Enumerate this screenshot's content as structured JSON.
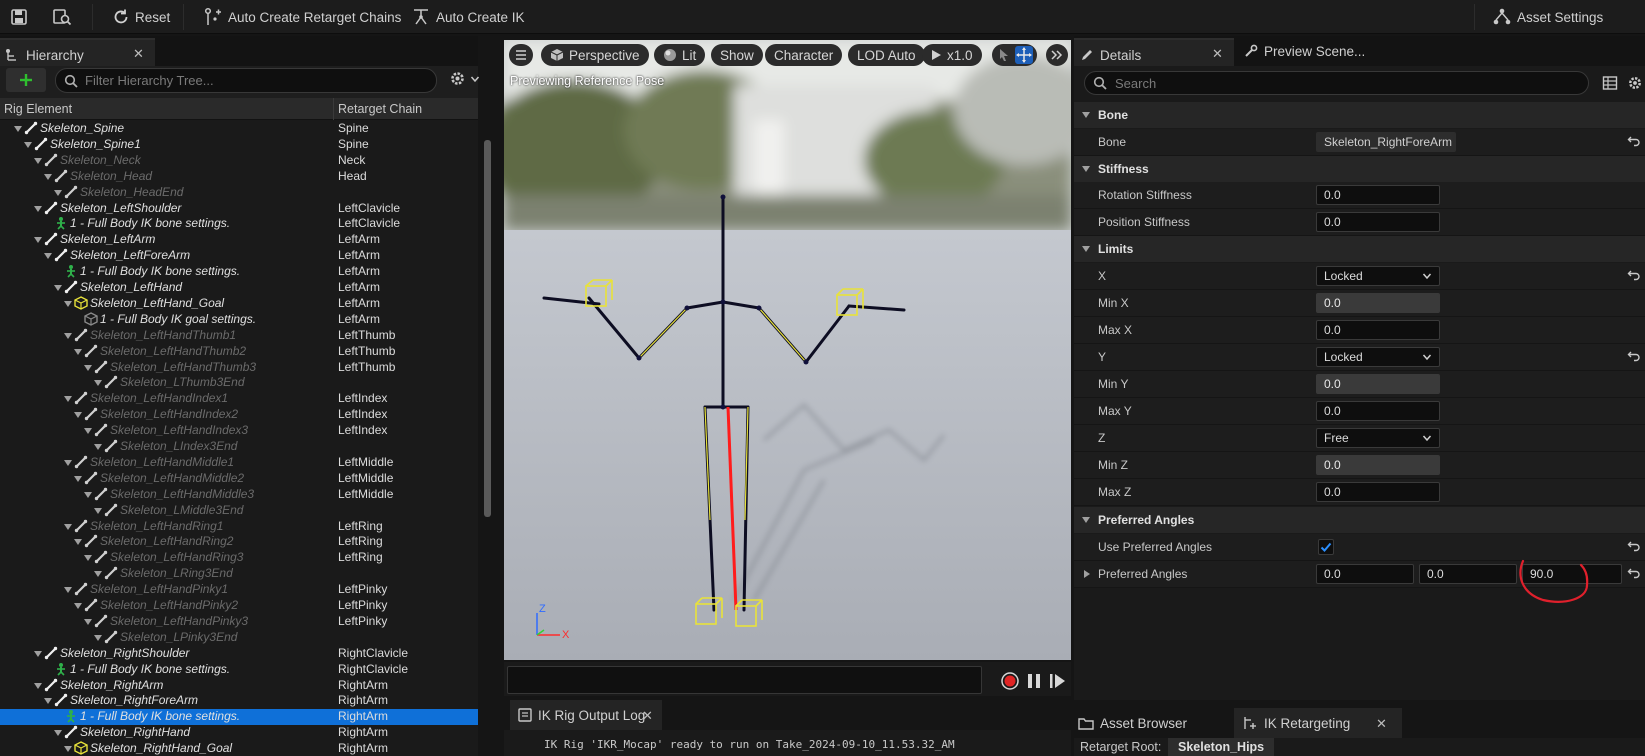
{
  "toolbar": {
    "reset_label": "Reset",
    "auto_chains_label": "Auto Create Retarget Chains",
    "auto_ik_label": "Auto Create IK",
    "asset_settings_label": "Asset Settings"
  },
  "hierarchy": {
    "tab_label": "Hierarchy",
    "filter_placeholder": "Filter Hierarchy Tree...",
    "col_element": "Rig Element",
    "col_chain": "Retarget Chain",
    "rows": [
      {
        "name": "Skeleton_Spine",
        "chain": "Spine"
      },
      {
        "name": "Skeleton_Spine1",
        "chain": "Spine"
      },
      {
        "name": "Skeleton_Neck",
        "chain": "Neck"
      },
      {
        "name": "Skeleton_Head",
        "chain": "Head"
      },
      {
        "name": "Skeleton_HeadEnd",
        "chain": ""
      },
      {
        "name": "Skeleton_LeftShoulder",
        "chain": "LeftClavicle"
      },
      {
        "name": "1 - Full Body IK bone settings.",
        "chain": "LeftClavicle"
      },
      {
        "name": "Skeleton_LeftArm",
        "chain": "LeftArm"
      },
      {
        "name": "Skeleton_LeftForeArm",
        "chain": "LeftArm"
      },
      {
        "name": "1 - Full Body IK bone settings.",
        "chain": "LeftArm"
      },
      {
        "name": "Skeleton_LeftHand",
        "chain": "LeftArm"
      },
      {
        "name": "Skeleton_LeftHand_Goal",
        "chain": "LeftArm"
      },
      {
        "name": "1 - Full Body IK goal settings.",
        "chain": "LeftArm"
      },
      {
        "name": "Skeleton_LeftHandThumb1",
        "chain": "LeftThumb"
      },
      {
        "name": "Skeleton_LeftHandThumb2",
        "chain": "LeftThumb"
      },
      {
        "name": "Skeleton_LeftHandThumb3",
        "chain": "LeftThumb"
      },
      {
        "name": "Skeleton_LThumb3End",
        "chain": ""
      },
      {
        "name": "Skeleton_LeftHandIndex1",
        "chain": "LeftIndex"
      },
      {
        "name": "Skeleton_LeftHandIndex2",
        "chain": "LeftIndex"
      },
      {
        "name": "Skeleton_LeftHandIndex3",
        "chain": "LeftIndex"
      },
      {
        "name": "Skeleton_LIndex3End",
        "chain": ""
      },
      {
        "name": "Skeleton_LeftHandMiddle1",
        "chain": "LeftMiddle"
      },
      {
        "name": "Skeleton_LeftHandMiddle2",
        "chain": "LeftMiddle"
      },
      {
        "name": "Skeleton_LeftHandMiddle3",
        "chain": "LeftMiddle"
      },
      {
        "name": "Skeleton_LMiddle3End",
        "chain": ""
      },
      {
        "name": "Skeleton_LeftHandRing1",
        "chain": "LeftRing"
      },
      {
        "name": "Skeleton_LeftHandRing2",
        "chain": "LeftRing"
      },
      {
        "name": "Skeleton_LeftHandRing3",
        "chain": "LeftRing"
      },
      {
        "name": "Skeleton_LRing3End",
        "chain": ""
      },
      {
        "name": "Skeleton_LeftHandPinky1",
        "chain": "LeftPinky"
      },
      {
        "name": "Skeleton_LeftHandPinky2",
        "chain": "LeftPinky"
      },
      {
        "name": "Skeleton_LeftHandPinky3",
        "chain": "LeftPinky"
      },
      {
        "name": "Skeleton_LPinky3End",
        "chain": ""
      },
      {
        "name": "Skeleton_RightShoulder",
        "chain": "RightClavicle"
      },
      {
        "name": "1 - Full Body IK bone settings.",
        "chain": "RightClavicle"
      },
      {
        "name": "Skeleton_RightArm",
        "chain": "RightArm"
      },
      {
        "name": "Skeleton_RightForeArm",
        "chain": "RightArm"
      },
      {
        "name": "1 - Full Body IK bone settings.",
        "chain": "RightArm"
      },
      {
        "name": "Skeleton_RightHand",
        "chain": "RightArm"
      },
      {
        "name": "Skeleton_RightHand_Goal",
        "chain": "RightArm"
      }
    ]
  },
  "viewport": {
    "perspective_label": "Perspective",
    "lit_label": "Lit",
    "show_label": "Show",
    "character_label": "Character",
    "lod_label": "LOD Auto",
    "speed_label": "x1.0",
    "caption": "Previewing Reference Pose",
    "axis_z": "Z",
    "axis_x": "X"
  },
  "output_log": {
    "tab_label": "IK Rig Output Log",
    "line": "IK Rig 'IKR_Mocap' ready to run on Take_2024-09-10_11.53.32_AM"
  },
  "details": {
    "tab_label": "Details",
    "preview_tab_label": "Preview Scene...",
    "search_placeholder": "Search",
    "bone_category": "Bone",
    "bone_label": "Bone",
    "bone_value": "Skeleton_RightForeArm",
    "stiffness_category": "Stiffness",
    "rotation_stiffness_label": "Rotation Stiffness",
    "rotation_stiffness_value": "0.0",
    "position_stiffness_label": "Position Stiffness",
    "position_stiffness_value": "0.0",
    "limits_category": "Limits",
    "x_label": "X",
    "x_value": "Locked",
    "min_x_label": "Min X",
    "min_x_value": "0.0",
    "max_x_label": "Max X",
    "max_x_value": "0.0",
    "y_label": "Y",
    "y_value": "Locked",
    "min_y_label": "Min Y",
    "min_y_value": "0.0",
    "max_y_label": "Max Y",
    "max_y_value": "0.0",
    "z_label": "Z",
    "z_value": "Free",
    "min_z_label": "Min Z",
    "min_z_value": "0.0",
    "max_z_label": "Max Z",
    "max_z_value": "0.0",
    "preferred_category": "Preferred Angles",
    "use_preferred_label": "Use Preferred Angles",
    "use_preferred_checked": true,
    "preferred_label": "Preferred Angles",
    "preferred_x": "0.0",
    "preferred_y": "0.0",
    "preferred_z": "90.0"
  },
  "bottom": {
    "asset_browser_label": "Asset Browser",
    "ik_retargeting_label": "IK Retargeting",
    "retarget_root_label": "Retarget Root:",
    "retarget_root_value": "Skeleton_Hips"
  },
  "colors": {
    "selection": "#0f70d8",
    "annotation": "#e0202c",
    "goal": "#e8e23a"
  }
}
